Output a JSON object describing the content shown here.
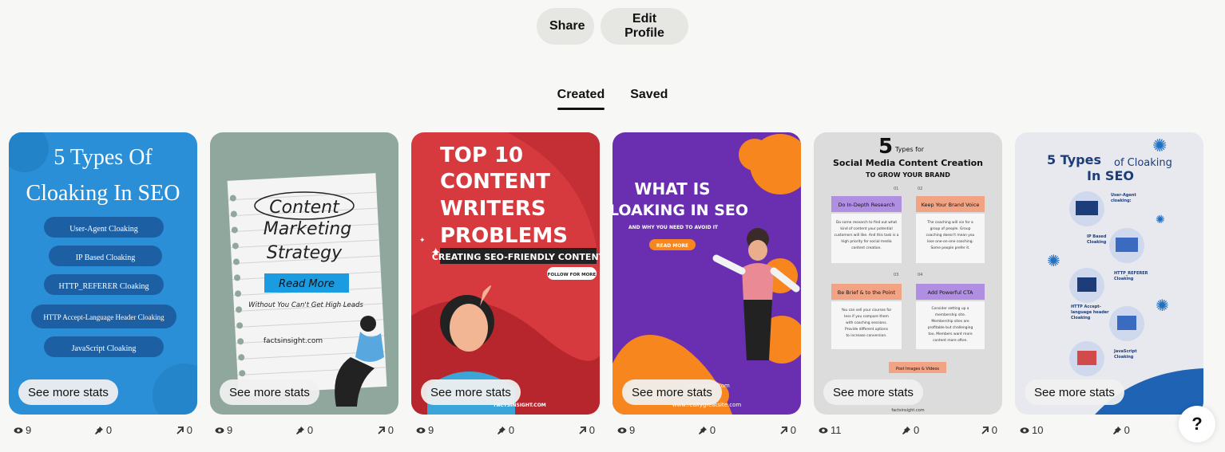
{
  "header": {
    "share_label": "Share",
    "edit_profile_label": "Edit Profile"
  },
  "tabs": [
    {
      "label": "Created",
      "active": true
    },
    {
      "label": "Saved",
      "active": false
    }
  ],
  "see_more_stats_label": "See more stats",
  "help_label": "?",
  "pins": [
    {
      "bg": "#2a8fd6",
      "texts": {
        "title1": "5 Types Of",
        "title2": "Cloaking In SEO",
        "item1": "User-Agent Cloaking",
        "item2": "IP Based Cloaking",
        "item3": "HTTP_REFERER Cloaking",
        "item4": "HTTP Accept-Language Header Cloaking",
        "item5": "JavaScript Cloaking"
      },
      "stats": {
        "views": "9",
        "saves": "0",
        "outbound": "0"
      }
    },
    {
      "bg": "#8fa79c",
      "texts": {
        "line1": "Content",
        "line2": "Marketing",
        "line3": "Strategy",
        "button": "Read More",
        "sub": "Without You Can't Get High Leads",
        "site": "factsinsight.com"
      },
      "stats": {
        "views": "9",
        "saves": "0",
        "outbound": "0"
      }
    },
    {
      "bg": "#d63a3f",
      "texts": {
        "line1": "TOP 10",
        "line2": "CONTENT",
        "line3": "WRITERS",
        "line4": "PROBLEMS",
        "banner": "CREATING SEO-FRIENDLY CONTENT",
        "follow": "FOLLOW FOR MORE",
        "site": "FACTSINSIGHT.COM"
      },
      "stats": {
        "views": "9",
        "saves": "0",
        "outbound": "0"
      }
    },
    {
      "bg": "#6a2fb0",
      "texts": {
        "line1": "WHAT IS",
        "line2": "CLOAKING IN SEO",
        "sub": "AND WHY YOU NEED TO AVOID IT",
        "button": "READ MORE",
        "site1": "factsinsight.com",
        "site2": "www.reallygreatsite.com"
      },
      "stats": {
        "views": "9",
        "saves": "0",
        "outbound": "0"
      }
    },
    {
      "bg": "#dcdcdc",
      "texts": {
        "num": "5",
        "types": "Types for",
        "title": "Social Media Content Creation",
        "subtitle": "TO GROW YOUR BRAND",
        "h1": "Do In-Depth Research",
        "h2": "Keep Your Brand Voice",
        "h3": "Be Brief & to the Point",
        "h4": "Add Powerful CTA",
        "n1": "01",
        "n2": "02",
        "n3": "03",
        "n4": "04",
        "p1a": "Do some research to find out what",
        "p1b": "kind of content your potential",
        "p1c": "customers will like. And this task is a",
        "p1d": "high priority for social media",
        "p1e": "content creation.",
        "p2a": "The coaching will vie for a",
        "p2b": "group of people. Group",
        "p2c": "coaching doesn't mean you",
        "p2d": "lose one-on-one coaching.",
        "p2e": "Some people prefer it.",
        "p3a": "You can sell your courses for",
        "p3b": "less if you compare them",
        "p3c": "with coaching sessions.",
        "p3d": "Provide different options",
        "p3e": "to increase conversion.",
        "p4a": "Consider setting up a",
        "p4b": "membership site.",
        "p4c": "Membership sites are",
        "p4d": "profitable but challenging",
        "p4e": "too. Members want more",
        "p4f": "content more often.",
        "post": "Post Images & Videos",
        "site": "factsinsight.com"
      },
      "stats": {
        "views": "11",
        "saves": "0",
        "outbound": "0"
      }
    },
    {
      "bg": "#e7e9ee",
      "texts": {
        "five": "5 Types",
        "of": "of Cloaking",
        "in": "In SEO",
        "s1": "User-Agent",
        "s1b": "cloaking:",
        "s2": "IP Based",
        "s2b": "Cloaking",
        "s3": "HTTP_REFERER",
        "s3b": "Cloaking",
        "s4": "HTTP Accept-",
        "s4b": "language header",
        "s4c": "Cloaking",
        "s5": "JavaScript",
        "s5b": "Cloaking"
      },
      "stats": {
        "views": "10",
        "saves": "0",
        "outbound": ""
      }
    }
  ]
}
